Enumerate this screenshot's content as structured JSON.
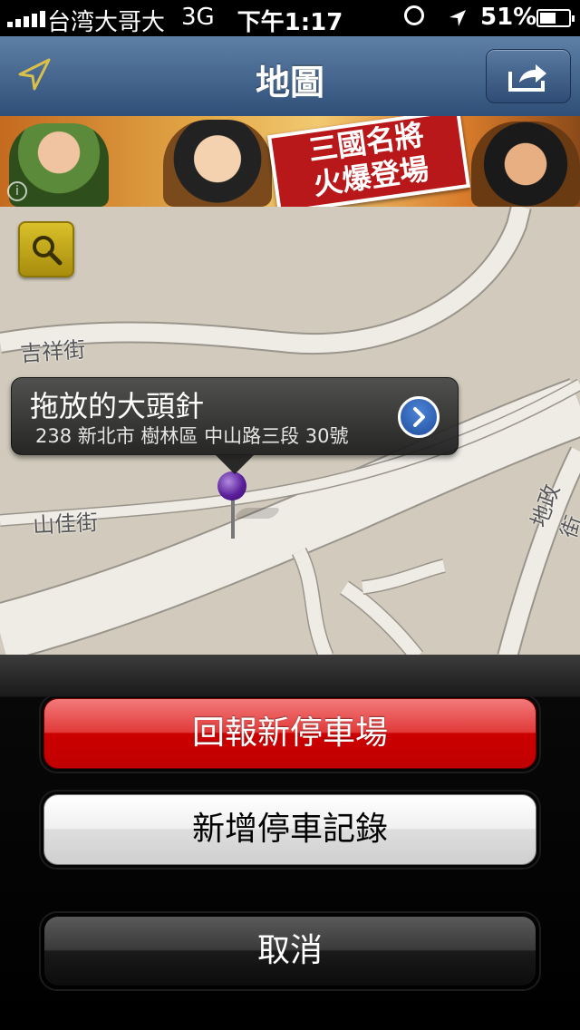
{
  "status_bar": {
    "carrier": "台湾大哥大",
    "network": "3G",
    "time": "下午1:17",
    "battery": "51%"
  },
  "nav": {
    "title": "地圖"
  },
  "banner": {
    "line1": "三國名將",
    "line2": "火爆登場"
  },
  "map": {
    "streets": [
      "吉祥街",
      "山佳街",
      "地政街"
    ],
    "callout": {
      "title": "拖放的大頭針",
      "subtitle": "238 新北市 樹林區 中山路三段 30號"
    }
  },
  "action_sheet": {
    "report_label": "回報新停車場",
    "add_label": "新增停車記錄",
    "cancel_label": "取消"
  },
  "colors": {
    "nav_bar": "#3f6190",
    "map_background": "#d2cbbd",
    "destructive": "#cc0000",
    "pin": "#5a1f9a"
  },
  "icons": [
    "location-arrow-icon",
    "share-icon",
    "search-icon",
    "disclosure-icon",
    "pin-icon"
  ]
}
